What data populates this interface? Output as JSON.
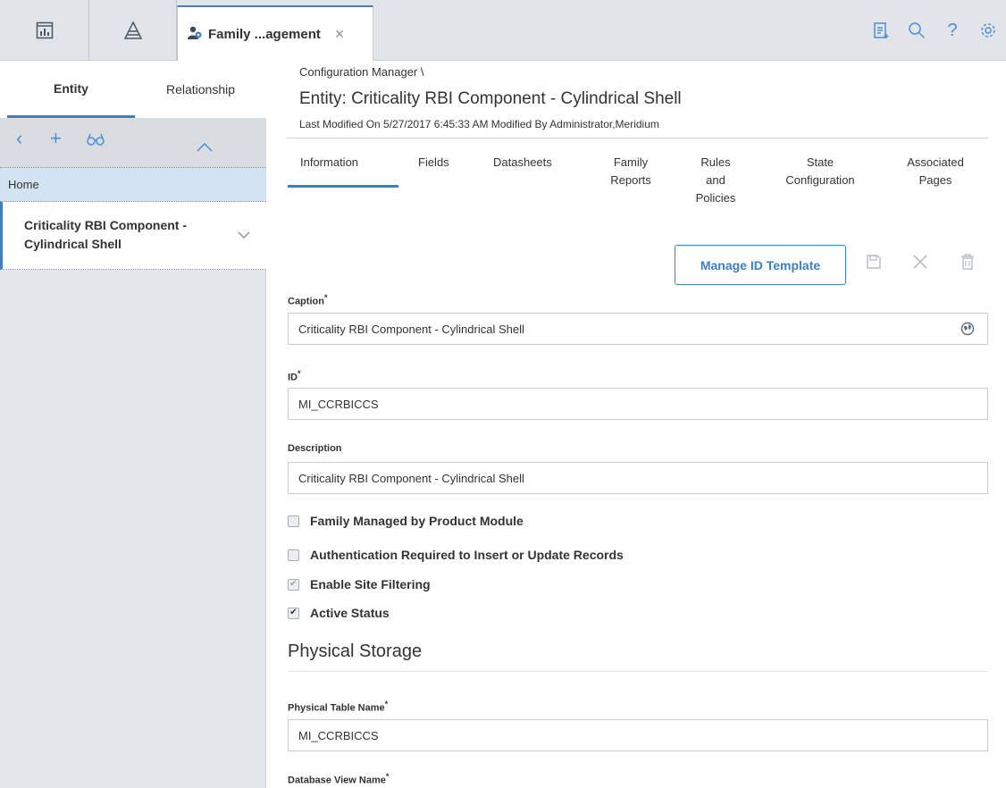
{
  "topbar": {
    "tabs": [
      {
        "title": "Family ...agement",
        "close": "×"
      }
    ],
    "icons": [
      "dashboard-icon",
      "pyramid-icon",
      "family-management-icon",
      "notepad-icon",
      "search-icon",
      "help-icon",
      "settings-icon"
    ],
    "help_glyph": "?"
  },
  "sidebar": {
    "tabs": [
      "Entity",
      "Relationship"
    ],
    "active_tab": "Entity",
    "toolbar": {
      "back": "‹",
      "add": "+",
      "find": "binoculars-icon",
      "collapse": "chevron-up-icon"
    },
    "home_label": "Home",
    "tree_item": "Criticality RBI Component - Cylindrical Shell"
  },
  "main": {
    "breadcrumb": "Configuration Manager \\",
    "title": "Entity: Criticality RBI Component - Cylindrical Shell",
    "modified": "Last Modified On 5/27/2017 6:45:33 AM Modified By Administrator,Meridium",
    "tabs": [
      {
        "label": "Information",
        "active": true
      },
      {
        "label": "Fields"
      },
      {
        "label": "Datasheets"
      },
      {
        "label": "Family Reports"
      },
      {
        "label": "Rules and Policies"
      },
      {
        "label": "State Configuration"
      },
      {
        "label": "Associated Pages"
      }
    ],
    "manage_button": "Manage ID Template",
    "fields": {
      "caption": {
        "label": "Caption",
        "value": "Criticality RBI Component - Cylindrical Shell"
      },
      "id": {
        "label": "ID",
        "value": "MI_CCRBICCS"
      },
      "description": {
        "label": "Description",
        "value": "Criticality RBI Component - Cylindrical Shell"
      },
      "physical_table": {
        "label": "Physical Table Name",
        "value": "MI_CCRBICCS"
      },
      "database_view": {
        "label": "Database View Name"
      }
    },
    "required_marker": "*",
    "checkboxes": [
      {
        "label": "Family Managed by Product Module",
        "checked": false
      },
      {
        "label": "Authentication Required to Insert or Update Records",
        "checked": false
      },
      {
        "label": "Enable Site Filtering",
        "checked": true,
        "disabled": true
      },
      {
        "label": "Active Status",
        "checked": true
      }
    ],
    "section_heading": "Physical Storage"
  },
  "colors": {
    "accent": "#3b80c7",
    "topbar": "#e1e4e9",
    "sidebar": "#e3e6ea",
    "home_row": "#d4e3f2"
  }
}
